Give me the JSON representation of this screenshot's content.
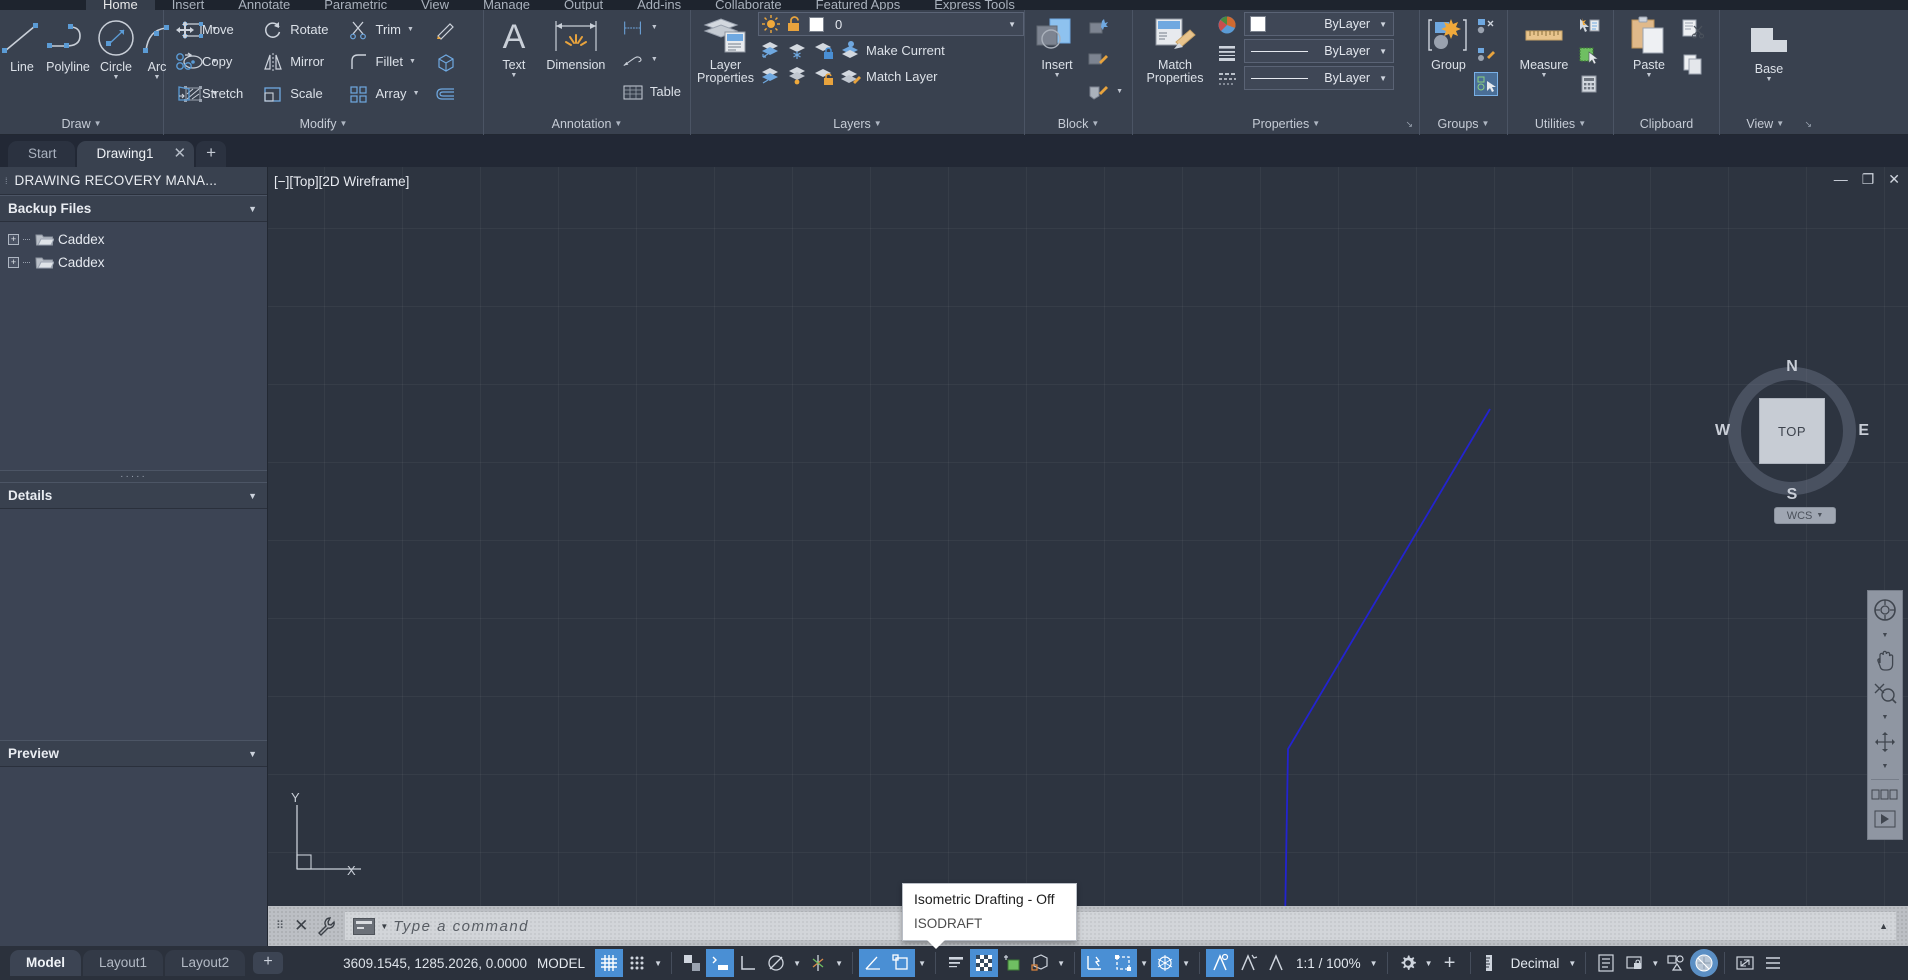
{
  "ribbon_tabs": [
    {
      "label": "Home",
      "active": true
    },
    {
      "label": "Insert",
      "active": false
    },
    {
      "label": "Annotate",
      "active": false
    },
    {
      "label": "Parametric",
      "active": false
    },
    {
      "label": "View",
      "active": false
    },
    {
      "label": "Manage",
      "active": false
    },
    {
      "label": "Output",
      "active": false
    },
    {
      "label": "Add-ins",
      "active": false
    },
    {
      "label": "Collaborate",
      "active": false
    },
    {
      "label": "Featured Apps",
      "active": false
    },
    {
      "label": "Express Tools",
      "active": false
    }
  ],
  "panels": {
    "draw": {
      "title": "Draw",
      "line": "Line",
      "polyline": "Polyline",
      "circle": "Circle",
      "arc": "Arc"
    },
    "modify": {
      "title": "Modify",
      "move": "Move",
      "rotate": "Rotate",
      "trim": "Trim",
      "copy": "Copy",
      "mirror": "Mirror",
      "fillet": "Fillet",
      "stretch": "Stretch",
      "scale": "Scale",
      "array": "Array"
    },
    "annotation": {
      "title": "Annotation",
      "text": "Text",
      "dimension": "Dimension",
      "table": "Table"
    },
    "layers": {
      "title": "Layers",
      "layer_properties": "Layer\nProperties",
      "layer_properties_l1": "Layer",
      "layer_properties_l2": "Properties",
      "current_layer": "0",
      "make_current": "Make Current",
      "match_layer": "Match Layer"
    },
    "block": {
      "title": "Block",
      "insert": "Insert"
    },
    "properties": {
      "title": "Properties",
      "match_properties_l1": "Match",
      "match_properties_l2": "Properties",
      "color": "ByLayer",
      "linetype": "ByLayer",
      "lineweight": "ByLayer"
    },
    "groups": {
      "title": "Groups",
      "group": "Group"
    },
    "utilities": {
      "title": "Utilities",
      "measure": "Measure"
    },
    "clipboard": {
      "title": "Clipboard",
      "paste": "Paste"
    },
    "view": {
      "title": "View",
      "base": "Base"
    }
  },
  "file_tabs": [
    {
      "label": "Start",
      "active": false,
      "closable": false
    },
    {
      "label": "Drawing1",
      "active": true,
      "closable": true
    }
  ],
  "file_tab_add": "+",
  "palette": {
    "title": "DRAWING RECOVERY MANA...",
    "backup_section": "Backup Files",
    "tree": [
      {
        "label": "Caddex"
      },
      {
        "label": "Caddex"
      }
    ],
    "details_section": "Details",
    "preview_section": "Preview"
  },
  "viewport": {
    "label": "[−][Top][2D Wireframe]",
    "viewcube": {
      "top": "TOP",
      "n": "N",
      "s": "S",
      "e": "E",
      "w": "W"
    },
    "wcs": "WCS",
    "ucs_y": "Y",
    "ucs_x": "X"
  },
  "tooltip": {
    "title": "Isometric Drafting - Off",
    "command": "ISODRAFT"
  },
  "command_line": {
    "placeholder": "Type a command"
  },
  "status_bar": {
    "layout_tabs": [
      {
        "label": "Model",
        "active": true
      },
      {
        "label": "Layout1",
        "active": false
      },
      {
        "label": "Layout2",
        "active": false
      }
    ],
    "layout_add": "+",
    "coordinates": "3609.1545, 1285.2026, 0.0000",
    "space": "MODEL",
    "annotation_scale": "1:1 / 100%",
    "units": "Decimal",
    "toggles": [
      {
        "name": "grid-display",
        "on": true
      },
      {
        "name": "snap-mode",
        "on": false
      },
      {
        "name": "infer-constraints",
        "on": false
      },
      {
        "name": "dynamic-input",
        "on": true
      },
      {
        "name": "ortho-mode",
        "on": false
      },
      {
        "name": "polar-tracking",
        "on": false
      },
      {
        "name": "isometric-drafting",
        "on": false
      },
      {
        "name": "object-snap-tracking",
        "on": true
      },
      {
        "name": "object-snap",
        "on": true
      },
      {
        "name": "lineweight",
        "on": false
      },
      {
        "name": "transparency",
        "on": true
      },
      {
        "name": "selection-cycling",
        "on": false
      },
      {
        "name": "3d-object-snap",
        "on": false
      },
      {
        "name": "dynamic-ucs",
        "on": true
      },
      {
        "name": "selection-filtering",
        "on": true
      },
      {
        "name": "gizmo",
        "on": true
      },
      {
        "name": "annotation-visibility",
        "on": true
      },
      {
        "name": "autoscale",
        "on": false
      },
      {
        "name": "annotation-scale-btn",
        "on": false
      }
    ]
  },
  "colors": {
    "ribbon_bg": "#39414f",
    "canvas_bg": "#2d3440",
    "accent_blue": "#4a8fd4",
    "polyline": "#2323d0",
    "icon_blue": "#6fa8e0",
    "icon_orange": "#e8a33d"
  }
}
